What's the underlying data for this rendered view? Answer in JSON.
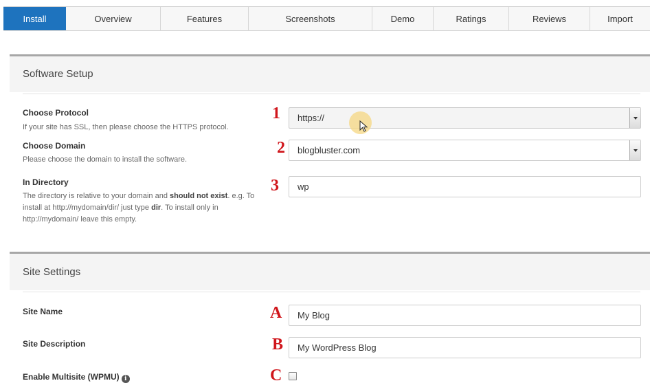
{
  "tabs": [
    "Install",
    "Overview",
    "Features",
    "Screenshots",
    "Demo",
    "Ratings",
    "Reviews",
    "Import"
  ],
  "software_setup": {
    "title": "Software Setup",
    "protocol": {
      "label": "Choose Protocol",
      "help": "If your site has SSL, then please choose the HTTPS protocol.",
      "value": "https://",
      "marker": "1"
    },
    "domain": {
      "label": "Choose Domain",
      "help": "Please choose the domain to install the software.",
      "value": "blogbluster.com",
      "marker": "2"
    },
    "directory": {
      "label": "In Directory",
      "help_pre": "The directory is relative to your domain and ",
      "help_bold1": "should not exist",
      "help_mid": ". e.g. To install at http://mydomain/dir/ just type ",
      "help_bold2": "dir",
      "help_post": ". To install only in http://mydomain/ leave this empty.",
      "value": "wp",
      "marker": "3"
    }
  },
  "site_settings": {
    "title": "Site Settings",
    "site_name": {
      "label": "Site Name",
      "value": "My Blog",
      "marker": "A"
    },
    "site_description": {
      "label": "Site Description",
      "value": "My WordPress Blog",
      "marker": "B"
    },
    "multisite": {
      "label": "Enable Multisite (WPMU)",
      "info_glyph": "i",
      "checked": false,
      "marker": "C"
    }
  },
  "colors": {
    "accent": "#1e73be",
    "marker": "#d0161c"
  }
}
